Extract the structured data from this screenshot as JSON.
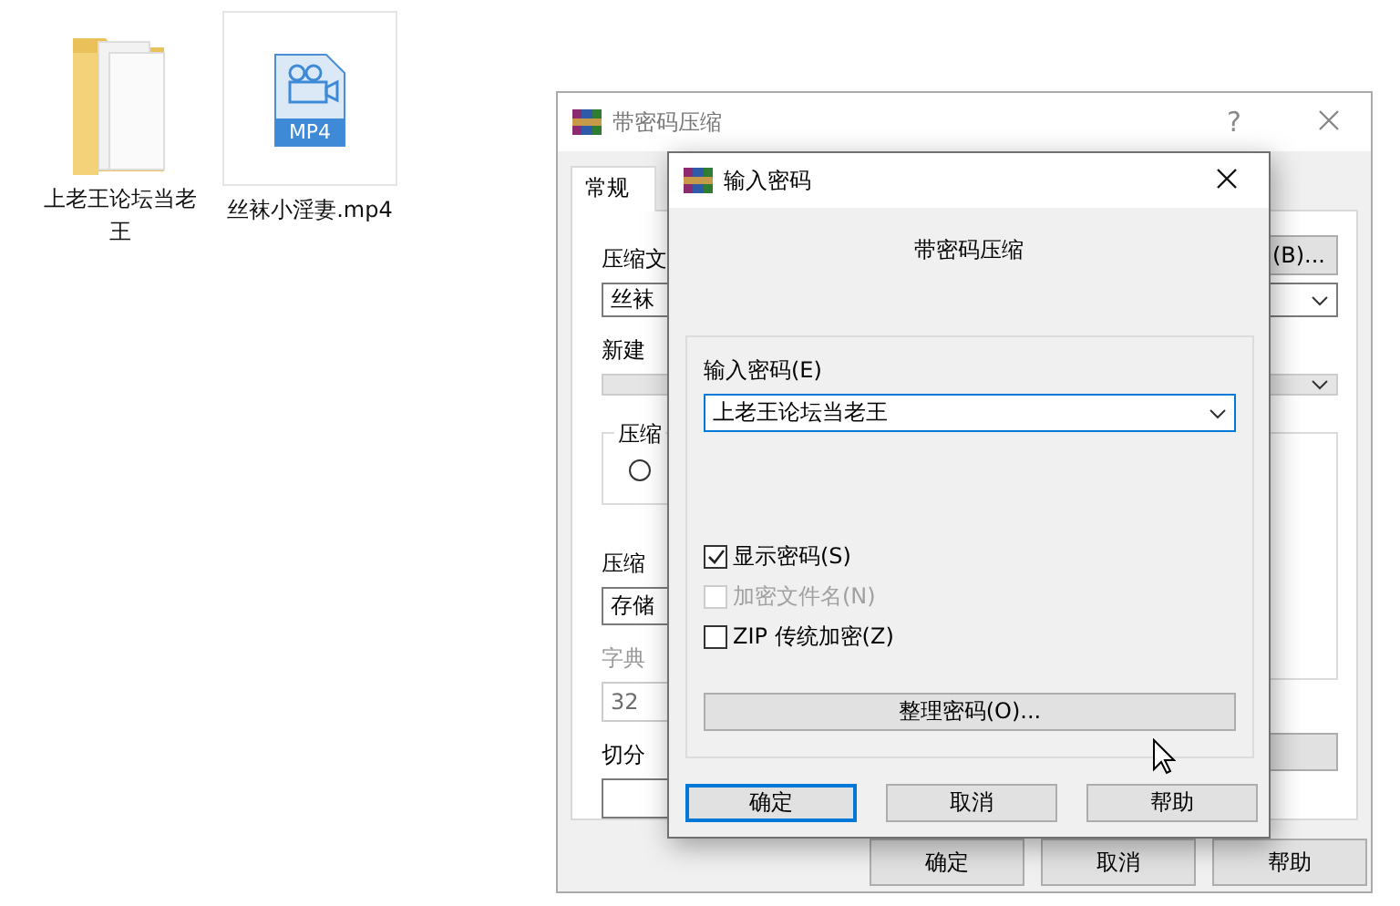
{
  "desktop": {
    "icons": [
      {
        "kind": "folder",
        "label": "上老王论坛当老王",
        "selected": false
      },
      {
        "kind": "video",
        "badge": "MP4",
        "label": "丝袜小淫妻.mp4",
        "selected": true
      }
    ]
  },
  "back_window": {
    "title": "带密码压缩",
    "help": "?",
    "tabs": [
      {
        "label": "常规",
        "selected": true
      }
    ],
    "rows": [
      {
        "kind": "label_button",
        "text": "压缩文",
        "button": "(B)..."
      },
      {
        "kind": "combo",
        "value": "丝袜"
      },
      {
        "kind": "label",
        "text": "新建"
      },
      {
        "kind": "combo",
        "disabled": true
      }
    ],
    "left_column": [
      {
        "kind": "group",
        "title": "压缩",
        "radio_selected": false
      },
      {
        "kind": "label",
        "text": "压缩"
      },
      {
        "kind": "combo",
        "value": "存储"
      },
      {
        "kind": "label",
        "text": "字典",
        "disabled": true
      },
      {
        "kind": "field",
        "value": "32",
        "disabled": true
      },
      {
        "kind": "label",
        "text": "切分"
      },
      {
        "kind": "field"
      }
    ],
    "buttons": [
      "确定",
      "取消",
      "帮助"
    ]
  },
  "front_window": {
    "title": "输入密码",
    "heading": "带密码压缩",
    "password_label": "输入密码(E)",
    "password": "上老王论坛当老王",
    "checkboxes": [
      {
        "label": "显示密码(S)",
        "checked": true,
        "disabled": false
      },
      {
        "label": "加密文件名(N)",
        "checked": false,
        "disabled": true
      },
      {
        "label": "ZIP 传统加密(Z)",
        "checked": false,
        "disabled": false
      }
    ],
    "manage_button": "整理密码(O)...",
    "buttons": [
      {
        "label": "确定",
        "default": true
      },
      {
        "label": "取消",
        "default": false
      },
      {
        "label": "帮助",
        "default": false
      }
    ]
  }
}
